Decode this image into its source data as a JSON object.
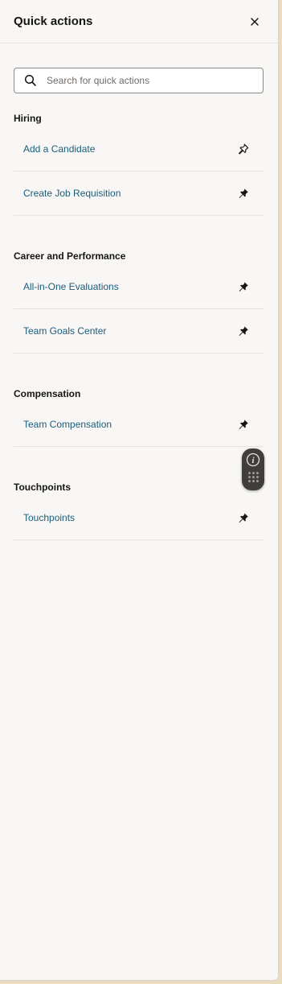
{
  "header": {
    "title": "Quick actions",
    "close_icon": "close-icon"
  },
  "search": {
    "placeholder": "Search for quick actions",
    "value": ""
  },
  "sections": [
    {
      "title": "Hiring",
      "items": [
        {
          "label": "Add a Candidate",
          "pinned": false
        },
        {
          "label": "Create Job Requisition",
          "pinned": true
        }
      ]
    },
    {
      "title": "Career and Performance",
      "items": [
        {
          "label": "All-in-One Evaluations",
          "pinned": true
        },
        {
          "label": "Team Goals Center",
          "pinned": true
        }
      ]
    },
    {
      "title": "Compensation",
      "items": [
        {
          "label": "Team Compensation",
          "pinned": true
        }
      ]
    },
    {
      "title": "Touchpoints",
      "items": [
        {
          "label": "Touchpoints",
          "pinned": true
        }
      ]
    }
  ],
  "colors": {
    "link": "#1a5c7a",
    "panel_bg": "#f8f7f5",
    "outer_bg": "#e9dcc1",
    "widget_bg": "#3f3e3b"
  },
  "floating_widget": {
    "icons": [
      "info-icon",
      "keypad-icon"
    ]
  }
}
